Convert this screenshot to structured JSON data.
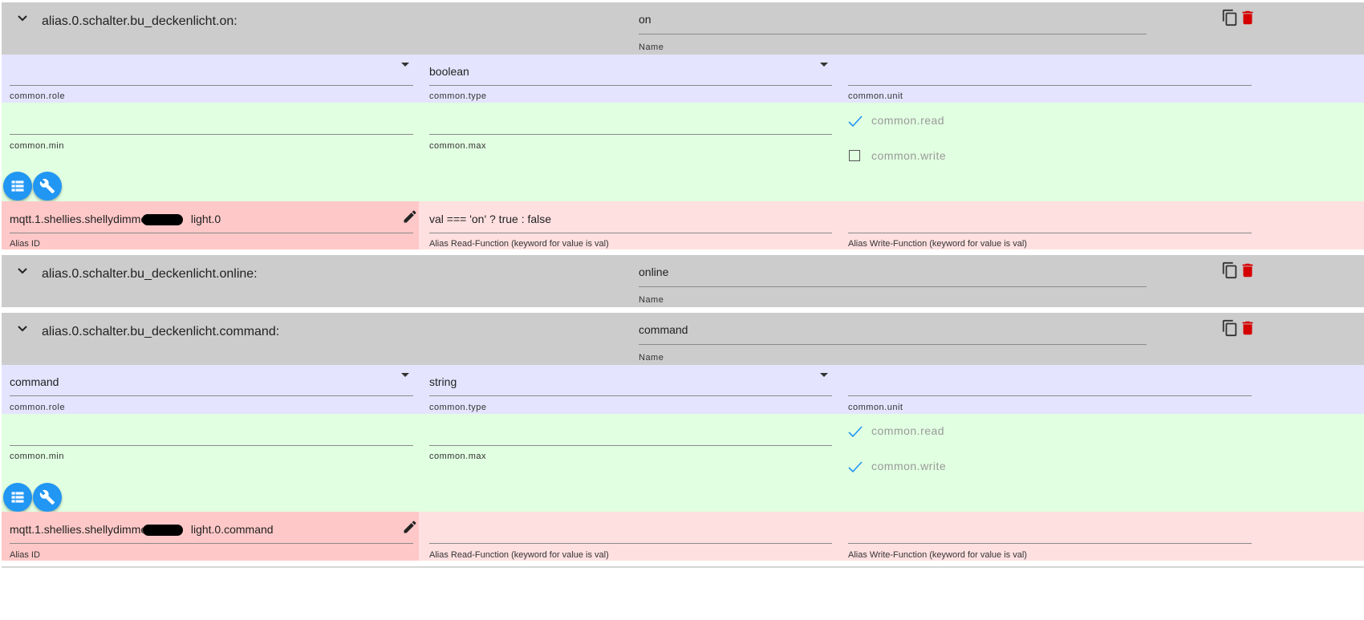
{
  "rows": [
    {
      "title": "alias.0.schalter.bu_deckenlicht.on:",
      "name": {
        "value": "on",
        "label": "Name"
      },
      "common": {
        "role": {
          "value": "",
          "label": "common.role"
        },
        "type": {
          "value": "boolean",
          "label": "common.type"
        },
        "unit": {
          "value": "",
          "label": "common.unit"
        },
        "min": {
          "value": "",
          "label": "common.min"
        },
        "max": {
          "value": "",
          "label": "common.max"
        },
        "read": {
          "label": "common.read",
          "checked": true
        },
        "write": {
          "label": "common.write",
          "checked": false
        }
      },
      "alias": {
        "id_prefix": "mqtt.1.shellies.shellydimmer",
        "id_suffix": "light.0",
        "id_label": "Alias ID",
        "read_fn": "val === 'on' ? true : false",
        "read_fn_label": "Alias Read-Function (keyword for value is val)",
        "write_fn": "",
        "write_fn_label": "Alias Write-Function (keyword for value is val)"
      }
    },
    {
      "title": "alias.0.schalter.bu_deckenlicht.online:",
      "name": {
        "value": "online",
        "label": "Name"
      }
    },
    {
      "title": "alias.0.schalter.bu_deckenlicht.command:",
      "name": {
        "value": "command",
        "label": "Name"
      },
      "common": {
        "role": {
          "value": "command",
          "label": "common.role"
        },
        "type": {
          "value": "string",
          "label": "common.type"
        },
        "unit": {
          "value": "",
          "label": "common.unit"
        },
        "min": {
          "value": "",
          "label": "common.min"
        },
        "max": {
          "value": "",
          "label": "common.max"
        },
        "read": {
          "label": "common.read",
          "checked": true
        },
        "write": {
          "label": "common.write",
          "checked": true
        }
      },
      "alias": {
        "id_prefix": "mqtt.1.shellies.shellydimmer",
        "id_suffix": "light.0.command",
        "id_label": "Alias ID",
        "read_fn": "",
        "read_fn_label": "Alias Read-Function (keyword for value is val)",
        "write_fn": "",
        "write_fn_label": "Alias Write-Function (keyword for value is val)"
      }
    }
  ],
  "icons": {
    "expand": "chevron-down-icon",
    "copy": "copy-icon",
    "delete": "trash-icon",
    "dropdown": "caret-down-icon",
    "check": "checkmark-icon",
    "list": "list-icon",
    "wrench": "wrench-icon",
    "edit": "pencil-icon"
  },
  "colors": {
    "header_bg": "#cccccc",
    "common_bg": "#e4e4ff",
    "flags_bg": "#e1ffe1",
    "alias_id_bg": "#ffc8c8",
    "alias_fn_bg": "#ffe0e0",
    "fab": "#2196f3",
    "delete": "#d50000",
    "check": "#2196f3"
  }
}
